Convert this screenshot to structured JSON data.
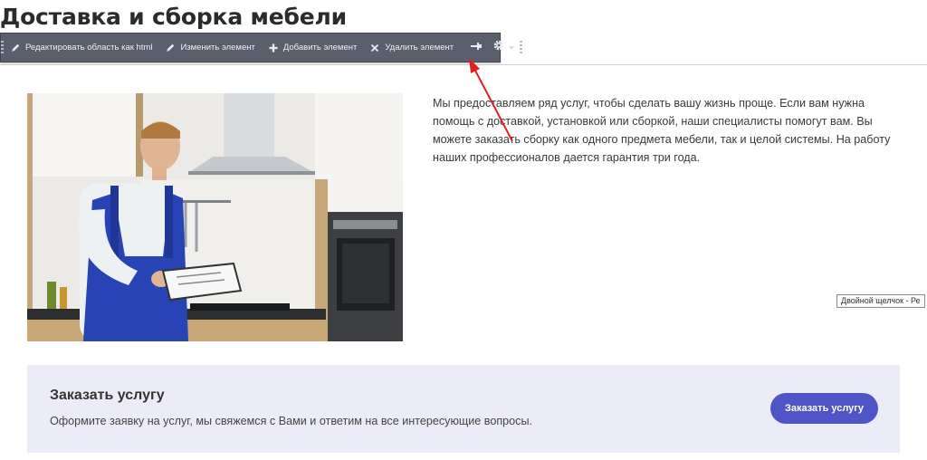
{
  "page": {
    "title": "Доставка и сборка мебели"
  },
  "toolbar": {
    "items": [
      {
        "label": "Редактировать область как html",
        "icon": "pencil-icon"
      },
      {
        "label": "Изменить элемент",
        "icon": "pencil-icon"
      },
      {
        "label": "Добавить элемент",
        "icon": "plus-icon"
      },
      {
        "label": "Удалить элемент",
        "icon": "close-icon"
      }
    ],
    "pin_icon": "pin-icon",
    "settings_icon": "gear-icon",
    "bg_color": "#5b5f6b"
  },
  "intro": {
    "text": "Мы предоставляем ряд услуг, чтобы сделать вашу жизнь проще. Если вам нужна помощь с доставкой, установкой или сборкой, наши специалисты помогут вам. Вы можете заказать сборку как одного предмета мебели, так и целой системы. На работу наших профессионалов дается гарантия три года."
  },
  "tooltip": {
    "text": "Двойной щелчок - Ре"
  },
  "cta": {
    "title": "Заказать услугу",
    "text": "Оформите заявку на услуг, мы свяжемся с Вами и ответим на все интересующие вопросы.",
    "button_label": "Заказать услугу",
    "bg_color": "#ececf9",
    "button_color": "#4f55c6"
  },
  "annotation": {
    "arrow_color": "#e32020"
  }
}
